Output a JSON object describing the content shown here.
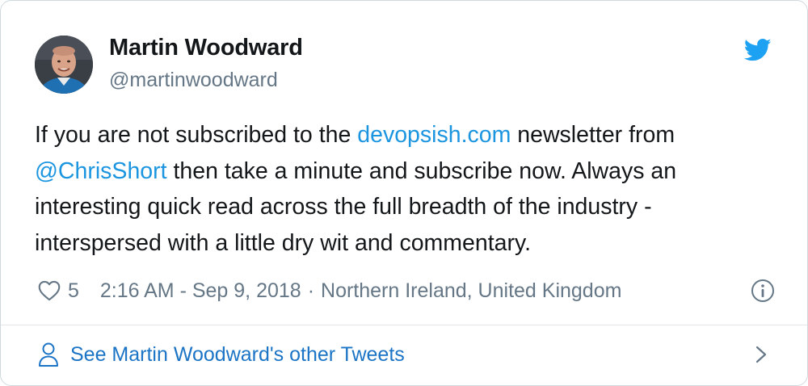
{
  "author": {
    "name": "Martin Woodward",
    "handle": "@martinwoodward"
  },
  "tweet": {
    "text_part1": "If you are not subscribed to the ",
    "link_domain": "devopsish.com",
    "text_part2": " newsletter from ",
    "mention": "@ChrisShort",
    "text_part3": " then take a minute and subscribe now. Always an interesting quick read across the full breadth of the industry - interspersed with a little dry wit and commentary."
  },
  "meta": {
    "like_count": "5",
    "timestamp": "2:16 AM - Sep 9, 2018",
    "separator": "·",
    "location": "Northern Ireland, United Kingdom"
  },
  "footer": {
    "see_more_label": "See Martin Woodward's other Tweets"
  },
  "icons": {
    "brand": "twitter-bird-icon",
    "like": "heart-icon",
    "info": "info-icon",
    "profile": "person-icon",
    "chevron": "chevron-right-icon"
  },
  "colors": {
    "link": "#1b95e0",
    "footer_link": "#1b74c5",
    "secondary_text": "#657786",
    "primary_text": "#14171a",
    "brand": "#1da1f2"
  }
}
